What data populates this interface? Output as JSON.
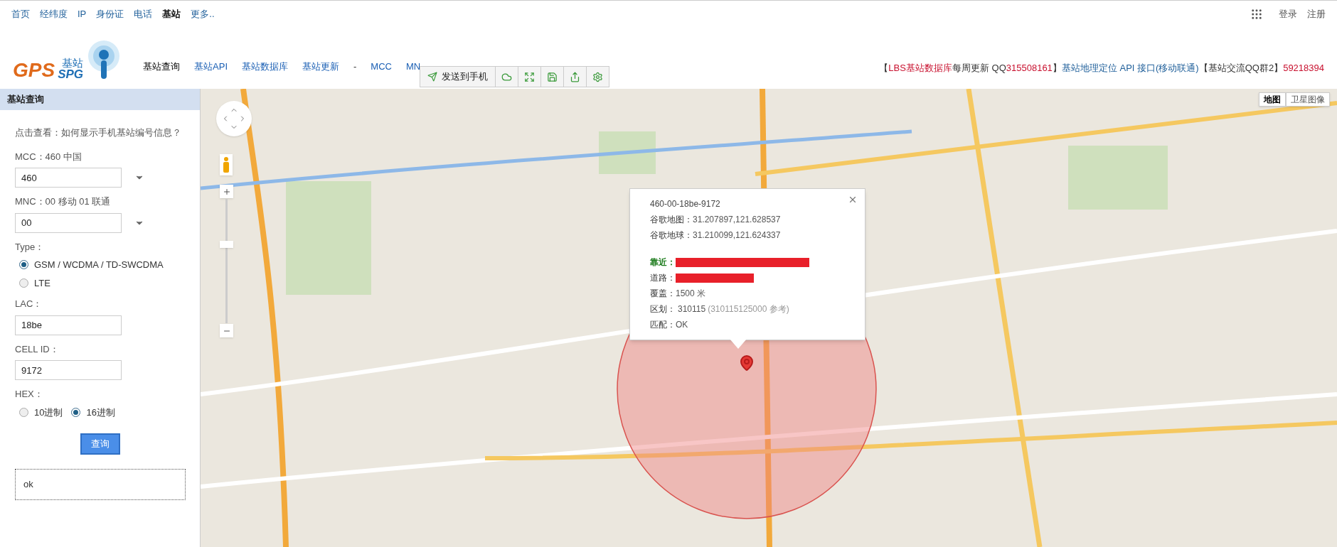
{
  "top_nav": {
    "items": [
      {
        "label": "首页",
        "selected": false
      },
      {
        "label": "经纬度",
        "selected": false
      },
      {
        "label": "IP",
        "selected": false
      },
      {
        "label": "身份证",
        "selected": false
      },
      {
        "label": "电话",
        "selected": false
      },
      {
        "label": "基站",
        "selected": true
      },
      {
        "label": "更多..",
        "selected": false
      }
    ],
    "login": "登录",
    "register": "注册"
  },
  "logo": {
    "gps": "GPS",
    "spg": "SPG",
    "sub": "基站"
  },
  "sub_nav": {
    "items": [
      {
        "kind": "link",
        "label": "基站查询",
        "selected": true
      },
      {
        "kind": "link",
        "label": "基站API",
        "selected": false
      },
      {
        "kind": "link",
        "label": "基站数据库",
        "selected": false
      },
      {
        "kind": "link",
        "label": "基站更新",
        "selected": false
      },
      {
        "kind": "separator",
        "label": "-"
      },
      {
        "kind": "link",
        "label": "MCC",
        "selected": false
      },
      {
        "kind": "link",
        "label": "MN",
        "selected": false
      }
    ]
  },
  "toolbar": {
    "send_label": "发送到手机"
  },
  "promo": {
    "parts": [
      {
        "kind": "plain",
        "text": "【"
      },
      {
        "kind": "highlight",
        "text": "LBS基站数据库"
      },
      {
        "kind": "plain",
        "text": "每周更新 QQ"
      },
      {
        "kind": "highlight",
        "text": "315508161"
      },
      {
        "kind": "plain",
        "text": "】"
      },
      {
        "kind": "link",
        "text": "基站地理定位 API 接口(移动联通)"
      },
      {
        "kind": "plain",
        "text": "【基站交流QQ群2】"
      },
      {
        "kind": "highlight",
        "text": "59218394"
      }
    ]
  },
  "panel": {
    "title": "基站查询",
    "help_link": "点击查看：如何显示手机基站编号信息？",
    "mcc": {
      "label": "MCC：460 中国",
      "value": "460"
    },
    "mnc": {
      "label": "MNC：00 移动 01 联通",
      "value": "00"
    },
    "type": {
      "label": "Type：",
      "options": [
        {
          "label": "GSM / WCDMA / TD-SWCDMA",
          "selected": true
        },
        {
          "label": "LTE",
          "selected": false
        }
      ]
    },
    "lac": {
      "label": "LAC：",
      "value": "18be"
    },
    "cell_id": {
      "label": "CELL ID：",
      "value": "9172"
    },
    "hex": {
      "label": "HEX：",
      "options": [
        {
          "label": "10进制",
          "selected": false
        },
        {
          "label": "16进制",
          "selected": true
        }
      ]
    },
    "query_button": "查询",
    "result": "ok"
  },
  "map": {
    "zoom": {
      "level": 0.64
    },
    "map_types": [
      {
        "label": "地图",
        "selected": true
      },
      {
        "label": "卫星图像",
        "selected": false
      }
    ],
    "popup": {
      "id": "460-00-18be-9172",
      "rows": [
        {
          "kind": "plain",
          "label": "谷歌地图：",
          "value": "31.207897,121.628537"
        },
        {
          "kind": "plain",
          "label": "谷歌地球：",
          "value": "31.210099,121.624337"
        },
        {
          "kind": "gap"
        },
        {
          "kind": "redacted",
          "label": "靠近：",
          "emphasis": true
        },
        {
          "kind": "redacted",
          "label": "道路：",
          "emphasis": false
        },
        {
          "kind": "plain",
          "label": "覆盖：",
          "value": "1500 米"
        },
        {
          "kind": "noted",
          "label": "区划：",
          "value": "310115",
          "note": "(310115125000 参考)"
        },
        {
          "kind": "plain",
          "label": "匹配：",
          "value": "OK"
        }
      ]
    }
  }
}
